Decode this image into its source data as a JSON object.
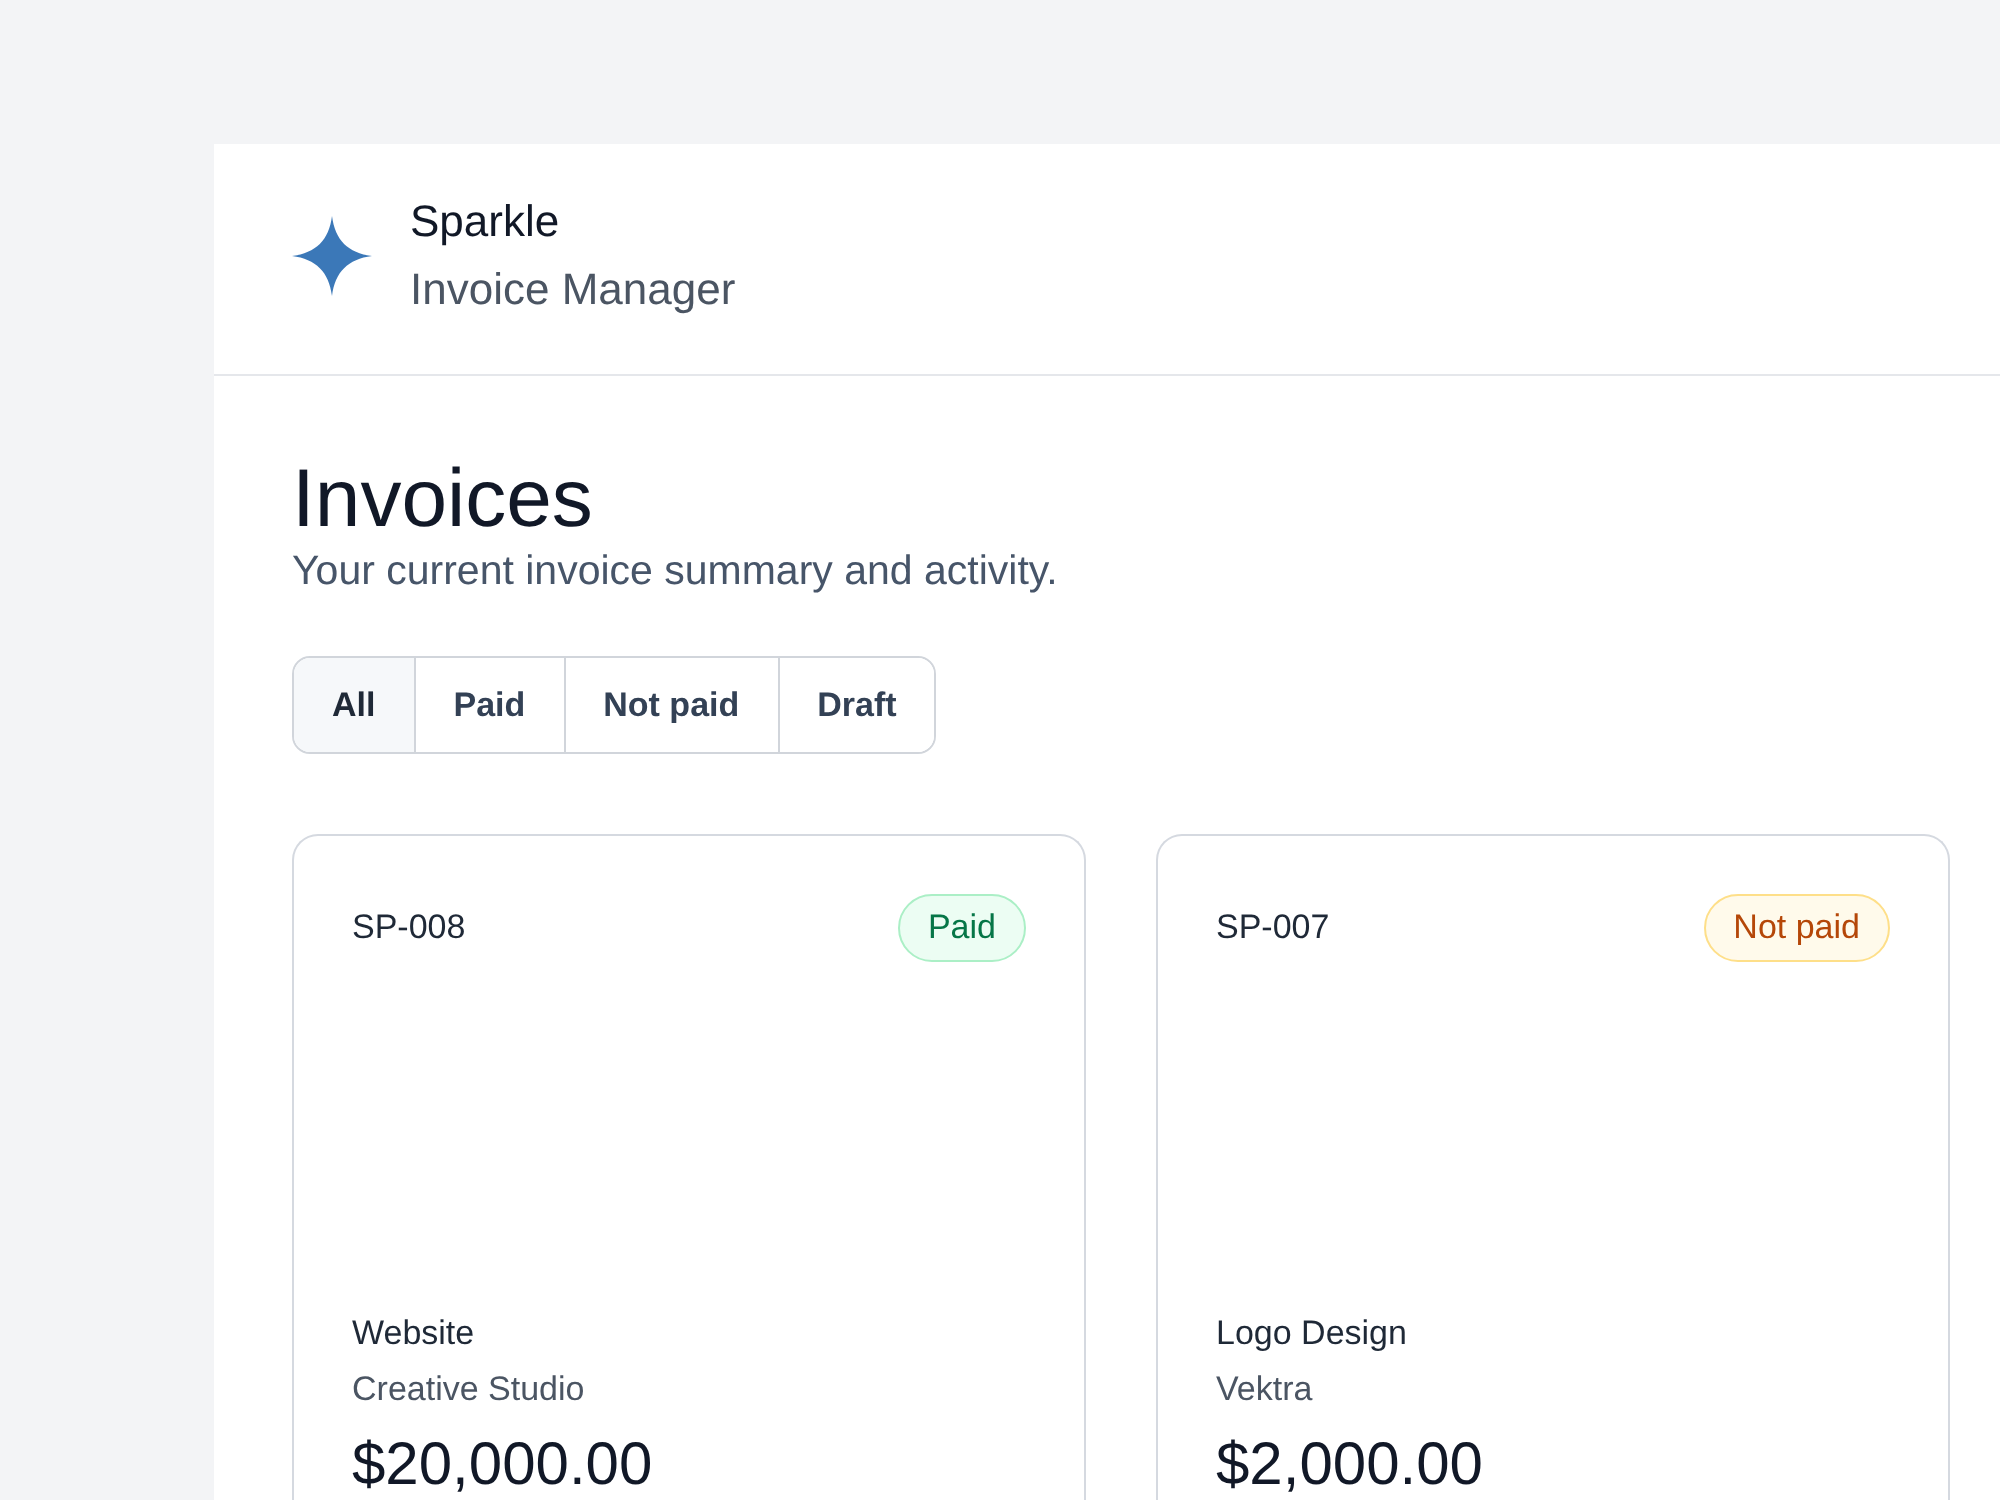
{
  "brand": {
    "name": "Sparkle",
    "subtitle": "Invoice Manager"
  },
  "page": {
    "title": "Invoices",
    "subtitle": "Your current invoice summary and activity."
  },
  "filters": [
    {
      "label": "All",
      "selected": true
    },
    {
      "label": "Paid",
      "selected": false
    },
    {
      "label": "Not paid",
      "selected": false
    },
    {
      "label": "Draft",
      "selected": false
    }
  ],
  "invoices": [
    {
      "number": "SP-008",
      "status": {
        "kind": "paid",
        "label": "Paid"
      },
      "project": "Website",
      "client": "Creative Studio",
      "amount": "$20,000.00"
    },
    {
      "number": "SP-007",
      "status": {
        "kind": "unpaid",
        "label": "Not paid"
      },
      "project": "Logo Design",
      "client": "Vektra",
      "amount": "$2,000.00"
    }
  ]
}
